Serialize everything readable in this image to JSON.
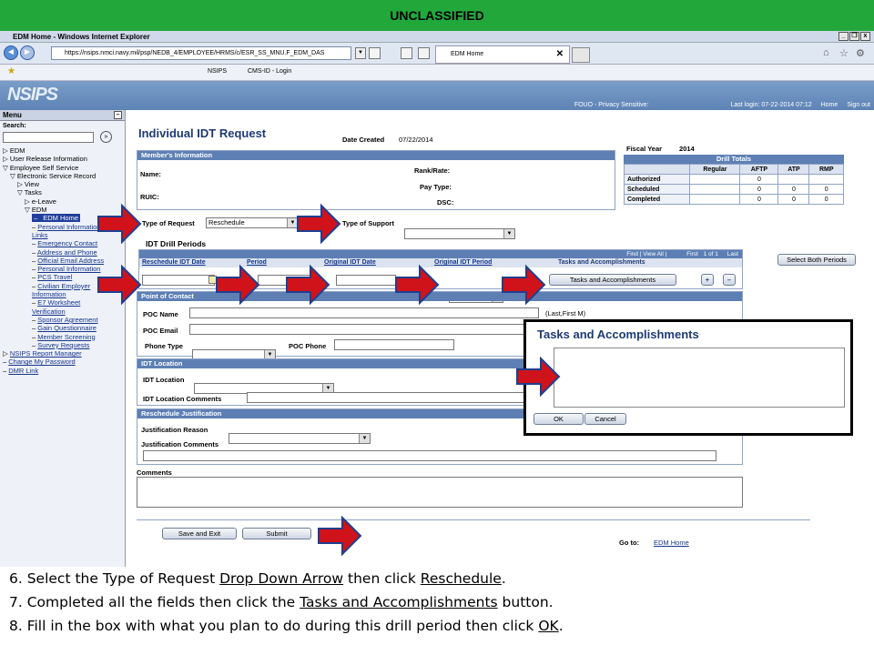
{
  "banner": "UNCLASSIFIED",
  "browser": {
    "window_title": "EDM Home - Windows Internet Explorer",
    "url": "https://nsips.nmci.navy.mil/psp/NEDB_4/EMPLOYEE/HRMS/c/ESR_SS_MNU.F_EDM_DAS",
    "tab_title": "EDM Home",
    "favorites": [
      "NSIPS",
      "CMS-ID - Login"
    ]
  },
  "header": {
    "logo": "NSIPS",
    "fouo": "FOUO - Privacy Sensitive:",
    "last_login": "Last login: 07-22-2014 07:12",
    "home": "Home",
    "signout": "Sign out"
  },
  "sidebar": {
    "title": "Menu",
    "search_label": "Search:",
    "go": "»",
    "items": [
      {
        "label": "EDM",
        "prefix": "▷ ",
        "indent": 0
      },
      {
        "label": "User Release Information",
        "prefix": "▷ ",
        "indent": 0
      },
      {
        "label": "Employee Self Service",
        "prefix": "▽ ",
        "indent": 0
      },
      {
        "label": "Electronic Service Record",
        "prefix": "▽ ",
        "indent": 1
      },
      {
        "label": "View",
        "prefix": "▷ ",
        "indent": 2
      },
      {
        "label": "Tasks",
        "prefix": "▽ ",
        "indent": 2
      },
      {
        "label": "e-Leave",
        "prefix": "▷ ",
        "indent": 3
      },
      {
        "label": "EDM",
        "prefix": "▽ ",
        "indent": 3
      },
      {
        "label": "EDM Home",
        "prefix": "– ",
        "indent": 4,
        "selected": true
      },
      {
        "label": "Personal Information",
        "prefix": "– ",
        "indent": 4,
        "link": true
      },
      {
        "label": "Links",
        "prefix": "",
        "indent": 4,
        "link": true
      },
      {
        "label": "Emergency Contact",
        "prefix": "– ",
        "indent": 4,
        "link": true
      },
      {
        "label": "Address and Phone",
        "prefix": "– ",
        "indent": 4,
        "link": true
      },
      {
        "label": "Official Email Address",
        "prefix": "– ",
        "indent": 4,
        "link": true
      },
      {
        "label": "Personal Information",
        "prefix": "– ",
        "indent": 4,
        "link": true
      },
      {
        "label": "PCS Travel",
        "prefix": "– ",
        "indent": 4,
        "link": true
      },
      {
        "label": "Civilian Employer",
        "prefix": "– ",
        "indent": 4,
        "link": true
      },
      {
        "label": "Information",
        "prefix": "",
        "indent": 4,
        "link": true
      },
      {
        "label": "E7 Worksheet",
        "prefix": "– ",
        "indent": 4,
        "link": true
      },
      {
        "label": "Verification",
        "prefix": "",
        "indent": 4,
        "link": true
      },
      {
        "label": "Sponsor Agreement",
        "prefix": "– ",
        "indent": 4,
        "link": true
      },
      {
        "label": "Gain Questionnaire",
        "prefix": "– ",
        "indent": 4,
        "link": true
      },
      {
        "label": "Member Screening",
        "prefix": "– ",
        "indent": 4,
        "link": true
      },
      {
        "label": "Survey Requests",
        "prefix": "– ",
        "indent": 4,
        "link": true
      },
      {
        "label": "NSIPS Report Manager",
        "prefix": "▷ ",
        "indent": 0,
        "link": true
      },
      {
        "label": "Change My Password",
        "prefix": "– ",
        "indent": 0,
        "link": true
      },
      {
        "label": "DMR Link",
        "prefix": "– ",
        "indent": 0,
        "link": true
      }
    ]
  },
  "form": {
    "title": "Individual IDT Request",
    "date_created_label": "Date Created",
    "date_created": "07/22/2014",
    "member_section": "Member's Information",
    "name_label": "Name:",
    "ruic_label": "RUIC:",
    "rank_label": "Rank/Rate:",
    "paytype_label": "Pay Type:",
    "dsc_label": "DSC:",
    "fiscal_year_label": "Fiscal Year",
    "fiscal_year": "2014",
    "drill_totals": {
      "title": "Drill Totals",
      "headers": [
        "",
        "Regular",
        "AFTP",
        "ATP",
        "RMP"
      ],
      "rows": [
        [
          "Authorized",
          "",
          "0",
          "",
          ""
        ],
        [
          "Scheduled",
          "",
          "0",
          "0",
          "0"
        ],
        [
          "Completed",
          "",
          "0",
          "0",
          "0"
        ]
      ]
    },
    "type_request_label": "Type of Request",
    "type_request_value": "Reschedule",
    "type_support_label": "Type of Support",
    "type_support_value": "",
    "idt_periods_title": "IDT Drill Periods",
    "grid_nav": "Find | View All |",
    "grid_first": "First",
    "grid_count": "1 of 1",
    "grid_last": "Last",
    "col_reschedule_date": "Reschedule IDT Date",
    "col_period": "Period",
    "col_original_date": "Original IDT Date",
    "col_original_period": "Original IDT Period",
    "col_tasks": "Tasks and Accomplishments",
    "tasks_button": "Tasks and Accomplishments",
    "select_both": "Select Both Periods",
    "poc_section": "Point of Contact",
    "poc_name_label": "POC Name",
    "poc_name_hint": "(Last,First M)",
    "poc_email_label": "POC Email",
    "phone_type_label": "Phone Type",
    "poc_phone_label": "POC Phone",
    "idt_location_section": "IDT Location",
    "idt_location_label": "IDT Location",
    "idt_location_comments_label": "IDT Location Comments",
    "reschedule_section": "Reschedule Justification",
    "justification_reason_label": "Justification Reason",
    "justification_comments_label": "Justification Comments",
    "comments_label": "Comments",
    "save_exit": "Save and Exit",
    "submit": "Submit",
    "goto_label": "Go to:",
    "goto_link": "EDM Home"
  },
  "popup": {
    "title": "Tasks and Accomplishments",
    "ok": "OK",
    "cancel": "Cancel"
  },
  "instructions": {
    "line6_pre": "6. Select the Type of Request ",
    "line6_u1": "Drop Down Arrow",
    "line6_mid": " then click ",
    "line6_u2": "Reschedule",
    "line6_post": ".",
    "line7_pre": "7. Completed all the fields then click the ",
    "line7_u1": "Tasks and Accomplishments",
    "line7_post": " button.",
    "line8_pre": "8. Fill in the box with what you plan to do during this drill period then click ",
    "line8_u1": "OK",
    "line8_post": "."
  },
  "colors": {
    "banner": "#22a83a",
    "section": "#5d7fb4",
    "arrow": "#d0121b",
    "arrow_outline": "#1f3e8f"
  }
}
